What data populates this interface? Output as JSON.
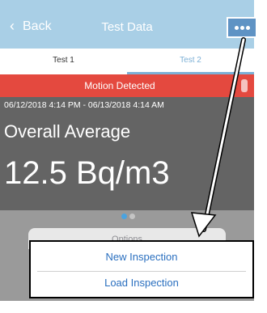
{
  "navbar": {
    "back_label": "Back",
    "title": "Test Data",
    "more_icon": "more-dots-icon"
  },
  "tabs": [
    {
      "label": "Test 1",
      "selected": false
    },
    {
      "label": "Test 2",
      "selected": true
    }
  ],
  "alert": {
    "text": "Motion Detected",
    "color": "#e4493f"
  },
  "data": {
    "date_range": "06/12/2018 4:14 PM - 06/13/2018 4:14 AM",
    "label": "Overall Average",
    "value": "12.5 Bq/m3"
  },
  "pager": {
    "count": 2,
    "active_index": 0
  },
  "action_sheet": {
    "title": "Options",
    "items": [
      {
        "label": "New Inspection"
      },
      {
        "label": "Load Inspection"
      }
    ]
  },
  "colors": {
    "nav_bar": "#a9cfe6",
    "tab_accent": "#7cb0d6",
    "data_panel": "#646464",
    "option_text": "#2a6fbf",
    "highlight_border": "#000000"
  }
}
